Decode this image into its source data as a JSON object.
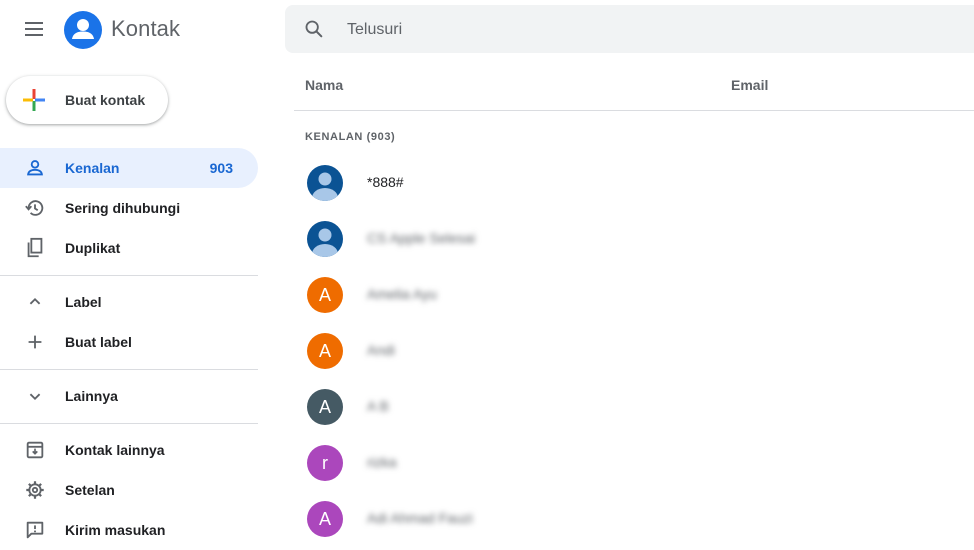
{
  "header": {
    "app_title": "Kontak",
    "search_placeholder": "Telusuri"
  },
  "create_button": {
    "label": "Buat kontak"
  },
  "sidebar": {
    "items": [
      {
        "label": "Kenalan",
        "count": "903",
        "icon": "person-icon",
        "active": true
      },
      {
        "label": "Sering dihubungi",
        "icon": "history-icon"
      },
      {
        "label": "Duplikat",
        "icon": "copy-icon"
      },
      {
        "label": "Label",
        "icon": "chevron-up-icon"
      },
      {
        "label": "Buat label",
        "icon": "plus-icon"
      },
      {
        "label": "Lainnya",
        "icon": "chevron-down-icon"
      },
      {
        "label": "Kontak lainnya",
        "icon": "archive-icon"
      },
      {
        "label": "Setelan",
        "icon": "gear-icon"
      },
      {
        "label": "Kirim masukan",
        "icon": "feedback-icon"
      }
    ]
  },
  "table": {
    "columns": [
      "Nama",
      "Email"
    ],
    "group_label": "KENALAN (903)",
    "rows": [
      {
        "avatar": "",
        "avatar_type": "person",
        "color": "#0b5394",
        "name": "*888#"
      },
      {
        "avatar": "",
        "avatar_type": "person",
        "color": "#0b5394",
        "name": "CS Apple Selesai",
        "blurred": true
      },
      {
        "avatar": "A",
        "avatar_type": "letter",
        "color": "#ef6c00",
        "name": "Amelia Ayu",
        "blurred": true
      },
      {
        "avatar": "A",
        "avatar_type": "letter",
        "color": "#ef6c00",
        "name": "Andi",
        "blurred": true
      },
      {
        "avatar": "A",
        "avatar_type": "letter",
        "color": "#455a64",
        "name": "A B",
        "blurred": true
      },
      {
        "avatar": "r",
        "avatar_type": "letter",
        "color": "#ab47bc",
        "name": "rizka",
        "blurred": true
      },
      {
        "avatar": "A",
        "avatar_type": "letter",
        "color": "#ab47bc",
        "name": "Adi Ahmad Fauzi",
        "blurred": true
      }
    ]
  },
  "colors": {
    "accent": "#1967d2",
    "active_bg": "#e8f0fe",
    "logo": "#1a73e8"
  }
}
